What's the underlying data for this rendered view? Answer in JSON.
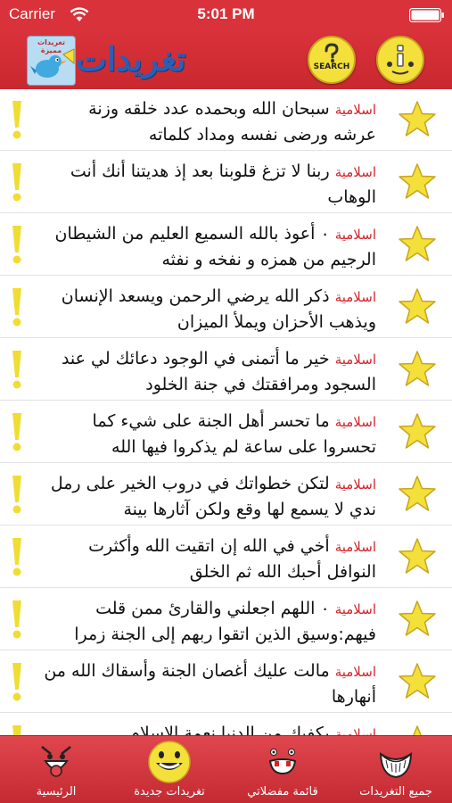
{
  "status_bar": {
    "carrier": "Carrier",
    "time": "5:01 PM"
  },
  "nav": {
    "title": "تغريدات",
    "logo_caption": "تغريدات مميزة",
    "search_label": "SEARCH",
    "icons": [
      "info-icon",
      "search-icon",
      "bird-logo-icon"
    ]
  },
  "tweets": [
    {
      "tag": "اسلامية",
      "line1": "سبحان الله وبحمده عدد خلقه وزنة",
      "line2": "عرشه ورضى نفسه ومداد كلماته"
    },
    {
      "tag": "اسلامية",
      "line1": "ربنا لا تزغ قلوبنا بعد إذ هديتنا أنك أنت",
      "line2": "الوهاب"
    },
    {
      "tag": "اسلامية",
      "line1": "٠ أعوذ بالله السميع العليم من الشيطان",
      "line2": "الرجيم من همزه و نفخه و نفثه"
    },
    {
      "tag": "اسلامية",
      "line1": "ذكر الله يرضي الرحمن ويسعد الإنسان",
      "line2": "ويذهب الأحزان ويملأ الميزان"
    },
    {
      "tag": "اسلامية",
      "line1": "خير ما أتمنى في الوجود دعائك لي عند",
      "line2": "السجود ومرافقتك في جنة الخلود"
    },
    {
      "tag": "اسلامية",
      "line1": "ما تحسر أهل الجنة على شيء كما",
      "line2": "تحسروا على ساعة لم يذكروا فيها الله"
    },
    {
      "tag": "اسلامية",
      "line1": "لتكن خطواتك في دروب الخير على رمل",
      "line2": "ندي لا يسمع لها وقع ولكن آثارها بينة"
    },
    {
      "tag": "اسلامية",
      "line1": "أخي في الله إن اتقيت الله وأكثرت",
      "line2": "النوافل أحبك الله ثم الخلق"
    },
    {
      "tag": "اسلامية",
      "line1": "٠ اللهم اجعلني والقارئ ممن قلت",
      "line2": "فيهم:وسيق الذين اتقوا ربهم إلى الجنة زمرا"
    },
    {
      "tag": "اسلامية",
      "line1": "مالت عليك أغصان الجنة وأسقاك الله من",
      "line2": "أنهارها"
    },
    {
      "tag": "اسلامية",
      "line1": "يكفيك من الدنيا نعمة الإسلام",
      "line2": ""
    }
  ],
  "tabs": [
    {
      "label": "جميع التغريدات",
      "icon": "big-smile-face-icon",
      "active": false
    },
    {
      "label": "قائمة مفضلاتي",
      "icon": "tongue-face-icon",
      "active": false
    },
    {
      "label": "تغريدات جديدة",
      "icon": "happy-face-icon",
      "active": true
    },
    {
      "label": "الرئيسية",
      "icon": "silly-face-icon",
      "active": false
    }
  ],
  "colors": {
    "brand_red": "#d9323a",
    "tag_red": "#d4232b",
    "star_yellow": "#f3e03a",
    "title_blue": "#2a5fb5"
  }
}
